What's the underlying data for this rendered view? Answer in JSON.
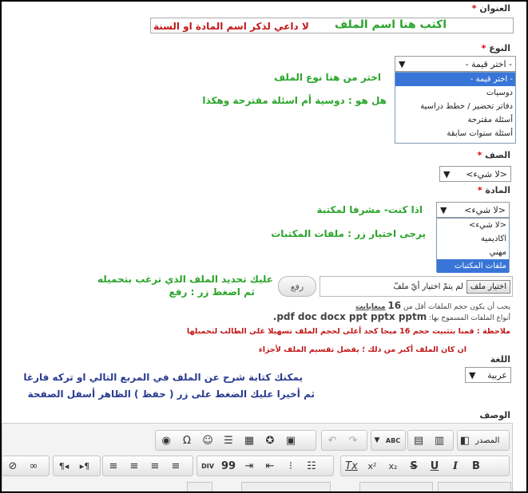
{
  "title_field": {
    "label": "العنوان",
    "required": "*",
    "value": ""
  },
  "title_notes": {
    "green": "اكتب هنا اسم الملف",
    "red": "لا داعي لذكر اسم المادة او السنة"
  },
  "type_field": {
    "label": "النوع",
    "required": "*",
    "selected": "- اختر قيمة -",
    "options": [
      "- اختر قيمة -",
      "دوسيات",
      "دفاتر تحضير / خطط دراسية",
      "أسئلة مقترحة",
      "أسئلة سنوات سابقة"
    ]
  },
  "type_notes": {
    "line1": "اختر من هنا نوع الملف",
    "line2": "هل هو : دوسية أم اسئلة مقترحة وهكذا"
  },
  "grade_field": {
    "label": "الصف",
    "required": "*",
    "selected": "<لا شيء>"
  },
  "subject_field": {
    "label": "المادة",
    "required": "*",
    "selected": "<لا شيء>",
    "options": [
      "<لا شيء>",
      "اكاديمية",
      "مهني",
      "ملفات المكتبات"
    ],
    "highlighted_index": 3
  },
  "subject_notes": {
    "line1": "اذا كنت- مشرفا لمكتبة",
    "line2": "يرجى اختيار زر : ملفات المكتبات"
  },
  "upload": {
    "choose_label": "اختيار ملف",
    "file_status": "لم يتمّ اختيار أيّ ملفّ",
    "upload_label": "رفع",
    "note1": "عليك  تحديد الملف الذي ترغب بتحميله",
    "note2": "ثم اضغط زر : رفع"
  },
  "file_rules": {
    "size_prefix": "يجب أن يكون حجم الملفات أقل من",
    "size_value": "16",
    "size_unit": "ميغابايت",
    "types_label": "أنواع الملفات المسموح بها:",
    "types_value": ".pdf doc docx ppt pptx pptm",
    "notice1": "ملاحظة : قمنا بتثبيت حجم 16 ميجا كحد أعلى لحجم الملف تسهيلا على الطالب لتحميلها",
    "notice2": "ان كان الملف أكبر من ذلك ؛ يفضل تقسيم الملف لأجزاء"
  },
  "language_field": {
    "label": "اللغة",
    "selected": "عربية"
  },
  "language_notes": {
    "line1": "يمكنك كتابة شرح عن الملف في المربع التالي او تركه فارغا",
    "line2": "ثم أخيرا عليك الضغط على زر ( حفظ ) الظاهر أسفل الصفحة"
  },
  "description_field": {
    "label": "الوصف"
  },
  "editor_toolbar": {
    "source_label": "المصدر",
    "icons_row1": [
      "source-icon",
      "templates-icon",
      "paste-word-icon",
      "paste-text-icon",
      "spellcheck-icon",
      "undo-icon",
      "redo-icon",
      "image-icon",
      "flash-icon",
      "table-icon",
      "hr-icon",
      "smiley-icon",
      "special-char-icon",
      "iframe-icon"
    ],
    "icons_row2": [
      "bold-icon",
      "italic-icon",
      "underline-icon",
      "strike-icon",
      "subscript-icon",
      "superscript-icon",
      "remove-format-icon",
      "numbered-list-icon",
      "bulleted-list-icon",
      "outdent-icon",
      "indent-icon",
      "blockquote-icon",
      "div-icon",
      "align-left-icon",
      "align-center-icon",
      "align-right-icon",
      "justify-icon",
      "ltr-icon",
      "rtl-icon",
      "link-icon",
      "unlink-icon"
    ],
    "glyphs": {
      "bold": "B",
      "italic": "I",
      "underline": "U",
      "strike": "S",
      "subscript": "x₂",
      "superscript": "x²",
      "remove_format": "Tx",
      "omega": "Ω",
      "spell": "ABC",
      "ltr": "¶◂",
      "rtl": "▸¶",
      "quote": "99",
      "div": "DIV"
    }
  }
}
